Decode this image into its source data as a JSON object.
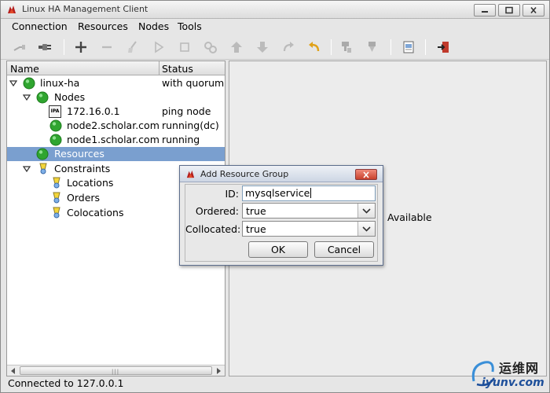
{
  "window": {
    "title": "Linux HA Management Client"
  },
  "menu": [
    "Connection",
    "Resources",
    "Nodes",
    "Tools"
  ],
  "toolbar": {
    "icons": [
      "disconnect-icon",
      "connect-icon",
      "add-icon",
      "remove-icon",
      "cleanup-icon",
      "start-icon",
      "stop-icon",
      "migrate-icon",
      "up-icon",
      "down-icon",
      "redo-icon",
      "undo-icon",
      "standby-icon",
      "active-icon",
      "view-icon",
      "exit-icon"
    ]
  },
  "tree": {
    "columns": {
      "name": "Name",
      "status": "Status"
    },
    "rows": [
      {
        "label": "linux-ha",
        "status": "with quorum"
      },
      {
        "label": "Nodes",
        "status": ""
      },
      {
        "label": "172.16.0.1",
        "status": "ping node"
      },
      {
        "label": "node2.scholar.com",
        "status": "running(dc)"
      },
      {
        "label": "node1.scholar.com",
        "status": "running"
      },
      {
        "label": "Resources",
        "status": ""
      },
      {
        "label": "Constraints",
        "status": ""
      },
      {
        "label": "Locations",
        "status": ""
      },
      {
        "label": "Orders",
        "status": ""
      },
      {
        "label": "Colocations",
        "status": ""
      }
    ],
    "ping_icon_text": "IPA"
  },
  "right_panel": {
    "text": "Available"
  },
  "status_bar": {
    "text": "Connected to 127.0.0.1"
  },
  "dialog": {
    "title": "Add Resource Group",
    "id_label": "ID:",
    "id_value": "mysqlservice",
    "ordered_label": "Ordered:",
    "ordered_value": "true",
    "collocated_label": "Collocated:",
    "collocated_value": "true",
    "ok_label": "OK",
    "cancel_label": "Cancel"
  },
  "watermark": {
    "top": "运维网",
    "bottom": "iyunv.com"
  },
  "colors": {
    "selection": "#7a9fcf",
    "node_green": "#2fa52f",
    "close_red": "#c8402c"
  }
}
